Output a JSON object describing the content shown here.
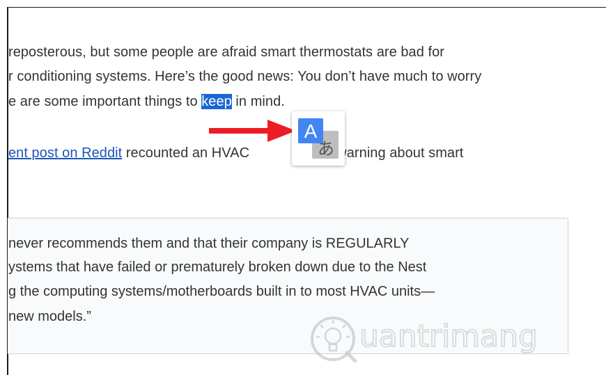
{
  "article": {
    "line1": "reposterous, but some people are afraid smart thermostats are bad for",
    "line2": "r conditioning systems. Here’s the good news: You don’t have much to worry",
    "line3_before": "e are some important things to ",
    "line3_selected": "keep",
    "line3_after": " in mind.",
    "line4_link": "ent post on Reddit",
    "line4_text_a": " recounted an HVAC",
    "line4_text_b": "ician’s warning about smart"
  },
  "quote": {
    "line1": " never recommends them and that their company is REGULARLY",
    "line2": "ystems that have failed or prematurely broken down due to the Nest",
    "line3": "g the computing systems/motherboards built in to most HVAC units—",
    "line4": "new models.”"
  },
  "translate_popup": {
    "icon": "google-translate-icon",
    "latin_glyph": "A",
    "kana_glyph": "あ"
  },
  "annotation": {
    "arrow_icon": "red-arrow-icon",
    "arrow_color": "#ee1c24"
  },
  "watermark": {
    "icon": "lightbulb-logo-icon",
    "text": "uantrimang"
  },
  "colors": {
    "selection": "#1967d2",
    "link": "#1c55b8",
    "translate_blue": "#4285f4",
    "translate_grey": "#bdbdbd"
  }
}
